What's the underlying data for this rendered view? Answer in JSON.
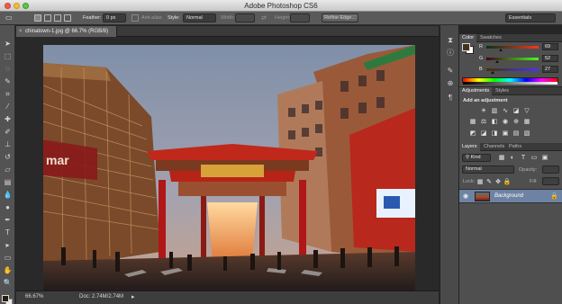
{
  "window": {
    "title": "Adobe Photoshop CS6"
  },
  "options_bar": {
    "feather_label": "Feather:",
    "feather_value": "0 px",
    "antialias_label": "Anti-alias",
    "style_label": "Style:",
    "style_value": "Normal",
    "width_label": "Width:",
    "height_label": "Height:",
    "refine_edge_label": "Refine Edge...",
    "workspace_value": "Essentials"
  },
  "document": {
    "tab_title": "chinatown-1.jpg @ 66.7% (RGB/8)",
    "zoom": "66.67%",
    "doc_size": "Doc: 2.74M/2.74M"
  },
  "color_panel": {
    "tabs": [
      "Color",
      "Swatches"
    ],
    "active_tab": "Color",
    "r_label": "R",
    "r_value": "69",
    "g_label": "G",
    "g_value": "52",
    "b_label": "B",
    "b_value": "27",
    "foreground_color": "#45341b",
    "background_color": "#ffffff"
  },
  "adjustments_panel": {
    "tabs": [
      "Adjustments",
      "Styles"
    ],
    "active_tab": "Adjustments",
    "heading": "Add an adjustment"
  },
  "layers_panel": {
    "tabs": [
      "Layers",
      "Channels",
      "Paths"
    ],
    "active_tab": "Layers",
    "kind_filter": "Kind",
    "blend_mode": "Normal",
    "opacity_label": "Opacity:",
    "lock_label": "Lock:",
    "fill_label": "Fill:",
    "layers": [
      {
        "name": "Background"
      }
    ]
  },
  "colors": {
    "app_bg": "#262626",
    "panel_bg": "#4f4f4f",
    "selected_layer": "#6e83a3"
  }
}
